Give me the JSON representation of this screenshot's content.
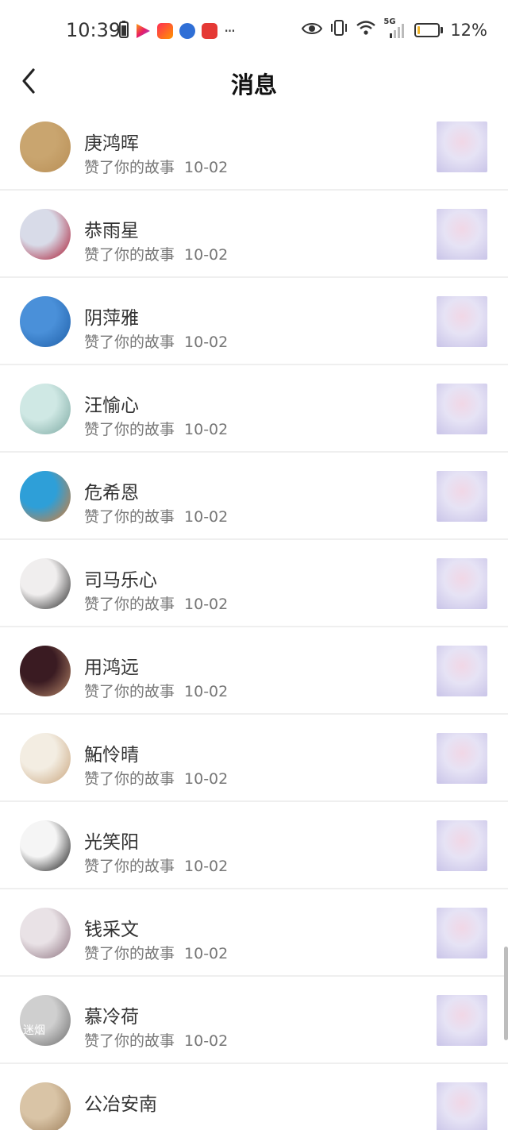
{
  "status_bar": {
    "time": "10:39",
    "battery_percent": "12%",
    "network": "5G",
    "more_dots": "···",
    "icons": [
      "battery-saver-icon",
      "video-app-icon",
      "shopping-app-icon",
      "browser-app-icon",
      "reader-app-icon",
      "eye-icon",
      "vibrate-icon",
      "wifi-icon",
      "signal-icon",
      "battery-icon"
    ],
    "battery_level": 0.12,
    "accent_battery": "#f0b429"
  },
  "header": {
    "title": "消息",
    "back_icon": "chevron-left-icon"
  },
  "notifications": [
    {
      "name": "",
      "action": "赞了你的故事",
      "date": "10-02",
      "avatar_colors": [
        "#e8dccd",
        "#b59b86"
      ]
    },
    {
      "name": "庚鸿晖",
      "action": "赞了你的故事",
      "date": "10-02",
      "avatar_colors": [
        "#c9a56f",
        "#b88e55"
      ]
    },
    {
      "name": "恭雨星",
      "action": "赞了你的故事",
      "date": "10-02",
      "avatar_colors": [
        "#d8dbe8",
        "#a8112a"
      ]
    },
    {
      "name": "阴萍雅",
      "action": "赞了你的故事",
      "date": "10-02",
      "avatar_colors": [
        "#4a90d9",
        "#1f5fa8"
      ]
    },
    {
      "name": "汪愉心",
      "action": "赞了你的故事",
      "date": "10-02",
      "avatar_colors": [
        "#cfe8e4",
        "#7aa7a0"
      ]
    },
    {
      "name": "危希恩",
      "action": "赞了你的故事",
      "date": "10-02",
      "avatar_colors": [
        "#2e9fd8",
        "#e07a2a"
      ]
    },
    {
      "name": "司马乐心",
      "action": "赞了你的故事",
      "date": "10-02",
      "avatar_colors": [
        "#f0eeee",
        "#222222"
      ]
    },
    {
      "name": "用鸿远",
      "action": "赞了你的故事",
      "date": "10-02",
      "avatar_colors": [
        "#3a1b22",
        "#b98a6a"
      ]
    },
    {
      "name": "鮖怜晴",
      "action": "赞了你的故事",
      "date": "10-02",
      "avatar_colors": [
        "#f3ede2",
        "#c8a37a"
      ]
    },
    {
      "name": "光笑阳",
      "action": "赞了你的故事",
      "date": "10-02",
      "avatar_colors": [
        "#f5f5f5",
        "#111111"
      ]
    },
    {
      "name": "钱采文",
      "action": "赞了你的故事",
      "date": "10-02",
      "avatar_colors": [
        "#e9e2e6",
        "#8a6f7c"
      ]
    },
    {
      "name": "慕冷荷",
      "action": "赞了你的故事",
      "date": "10-02",
      "avatar_colors": [
        "#cfcfcf",
        "#6a6a6a"
      ],
      "avatar_text": "迷烟"
    },
    {
      "name": "公冶安南",
      "action": "",
      "date": "",
      "avatar_colors": [
        "#d9c4a6",
        "#9c7d59"
      ]
    }
  ],
  "thumbnail_colors": [
    "#e6e3f5",
    "#c9c4e8",
    "#f1d7e6"
  ]
}
